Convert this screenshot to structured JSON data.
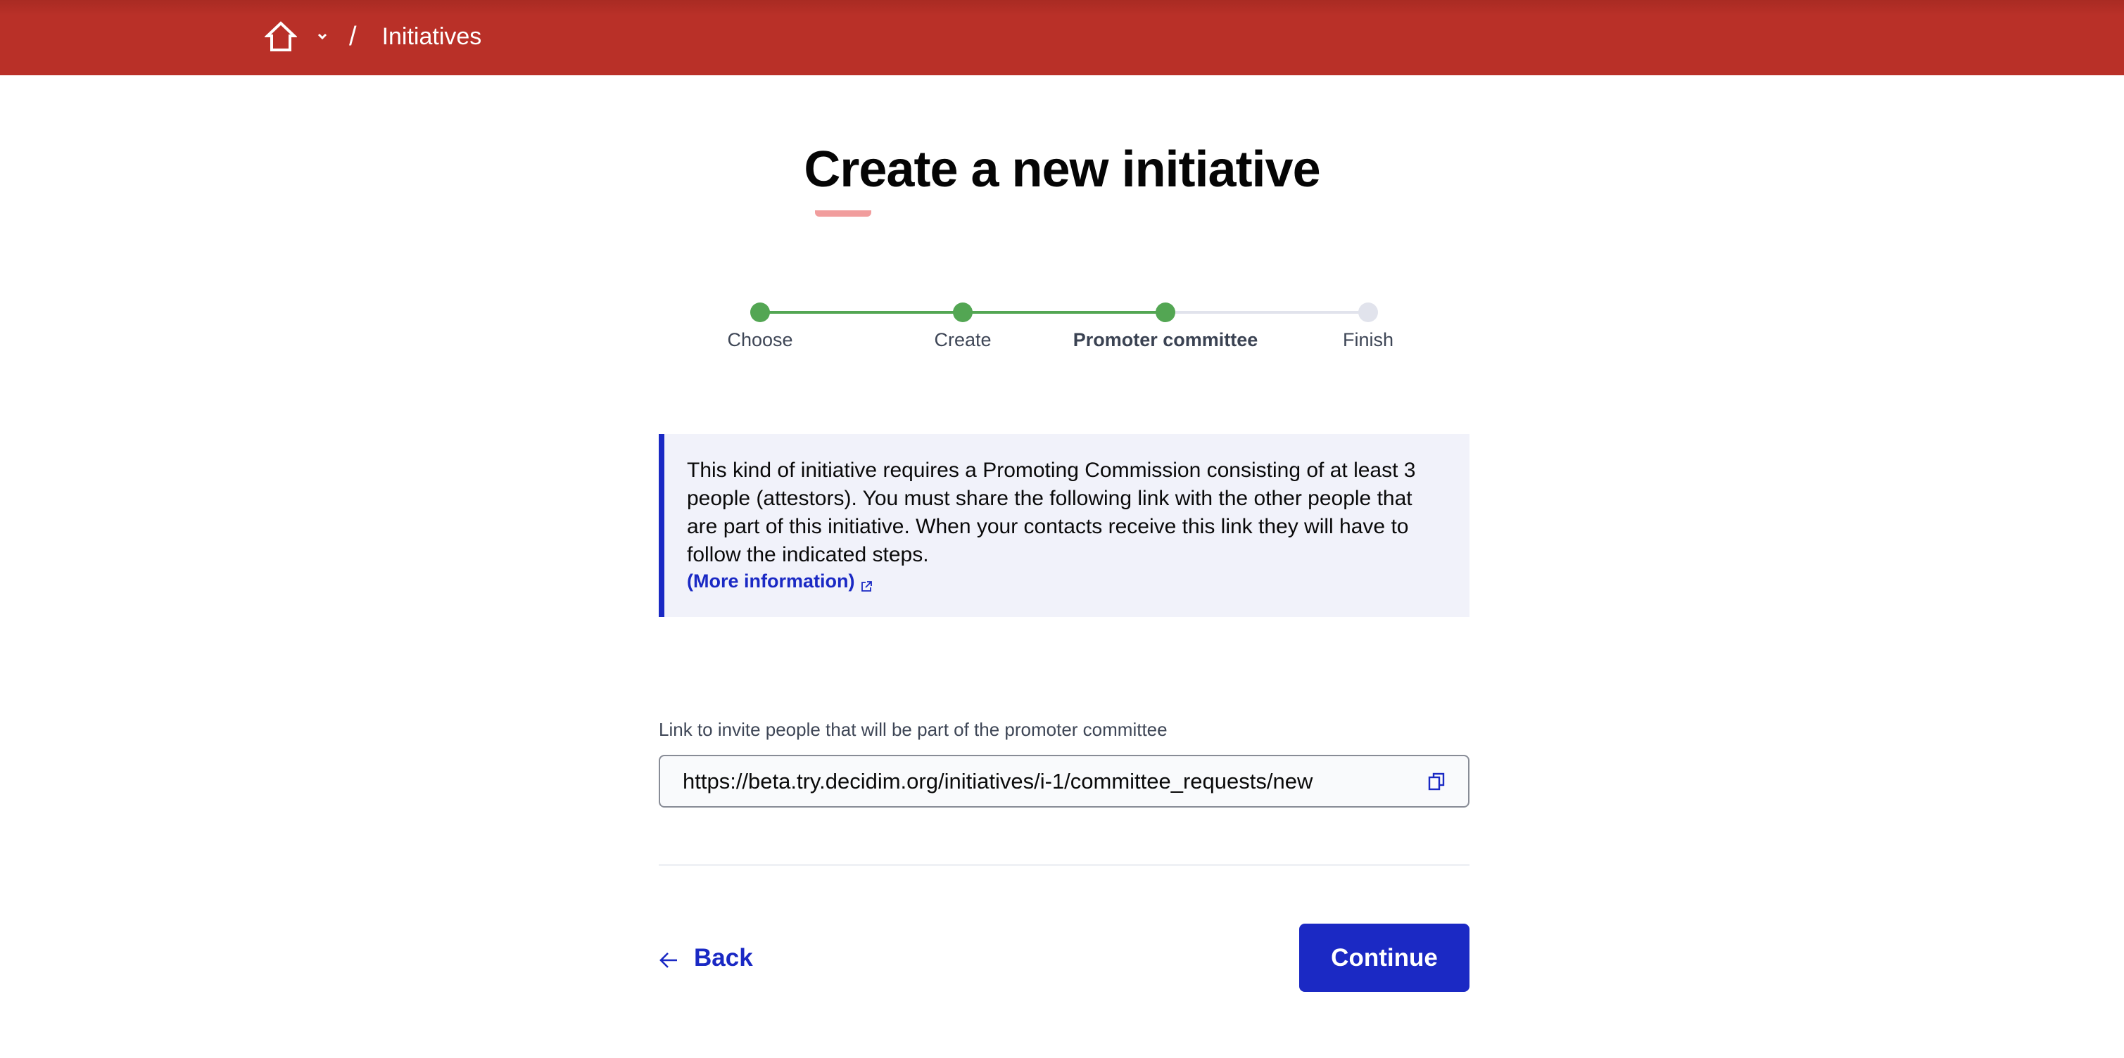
{
  "header": {
    "home_icon": "home-icon",
    "dropdown_icon": "chevron-down-icon",
    "separator": "/",
    "breadcrumb_current": "Initiatives",
    "brand_color": "#b93028"
  },
  "page": {
    "title": "Create a new initiative"
  },
  "stepper": {
    "current_index": 2,
    "steps": [
      {
        "label": "Choose",
        "status": "complete"
      },
      {
        "label": "Create",
        "status": "complete"
      },
      {
        "label": "Promoter committee",
        "status": "current"
      },
      {
        "label": "Finish",
        "status": "pending"
      }
    ],
    "colors": {
      "complete": "#53a653",
      "pending": "#e1e3ec"
    }
  },
  "callout": {
    "text": "This kind of initiative requires a Promoting Commission consisting of at least 3 people (attestors). You must share the following link with the other people that are part of this initiative. When your contacts receive this link they will have to follow the indicated steps.",
    "link_label": "(More information)",
    "link_icon": "external-link-icon",
    "accent_color": "#1a29c4"
  },
  "invite": {
    "label": "Link to invite people that will be part of the promoter committee",
    "value": "https://beta.try.decidim.org/initiatives/i-1/committee_requests/new",
    "copy_icon": "copy-icon"
  },
  "actions": {
    "back_label": "Back",
    "back_icon": "arrow-left-icon",
    "continue_label": "Continue",
    "primary_color": "#1b29c4"
  }
}
